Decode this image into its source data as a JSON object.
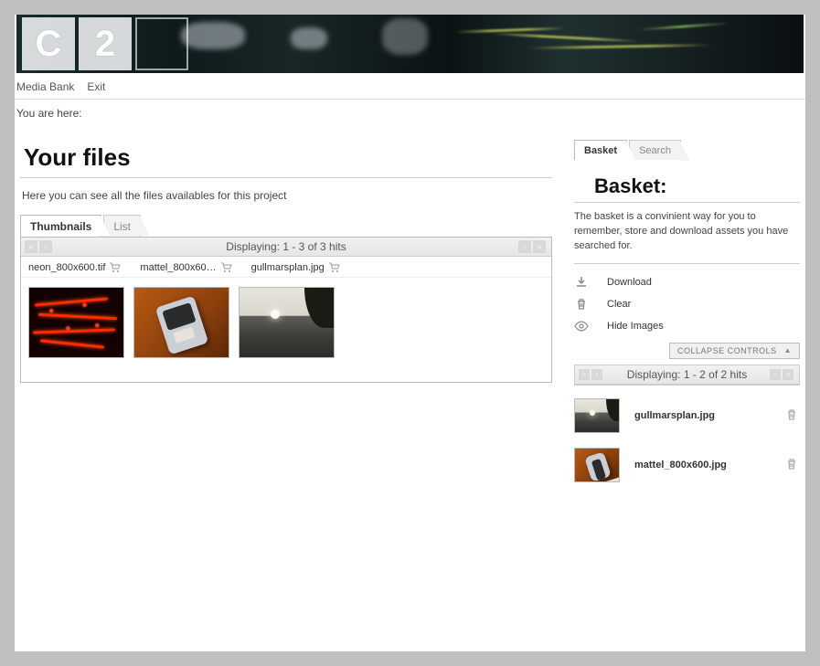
{
  "logo": {
    "t1": "C",
    "t2": "2"
  },
  "nav": {
    "media_bank": "Media Bank",
    "exit": "Exit"
  },
  "breadcrumb_label": "You are here:",
  "main": {
    "title": "Your files",
    "intro": "Here you can see all the files availables for this project",
    "tabs": {
      "thumbnails": "Thumbnails",
      "list": "List"
    },
    "pager_text": "Displaying: 1 - 3 of 3 hits",
    "files": [
      {
        "name": "neon_800x600.tif"
      },
      {
        "name": "mattel_800x60…"
      },
      {
        "name": "gullmarsplan.jpg"
      }
    ]
  },
  "side": {
    "tabs": {
      "basket": "Basket",
      "search": "Search"
    },
    "title": "Basket:",
    "description": "The basket is a convinient way for you to remember, store and download assets you have searched for.",
    "actions": {
      "download": "Download",
      "clear": "Clear",
      "hide_images": "Hide Images"
    },
    "collapse_label": "COLLAPSE CONTROLS",
    "pager_text": "Displaying: 1 - 2 of 2 hits",
    "items": [
      {
        "name": "gullmarsplan.jpg"
      },
      {
        "name": "mattel_800x600.jpg"
      }
    ]
  }
}
